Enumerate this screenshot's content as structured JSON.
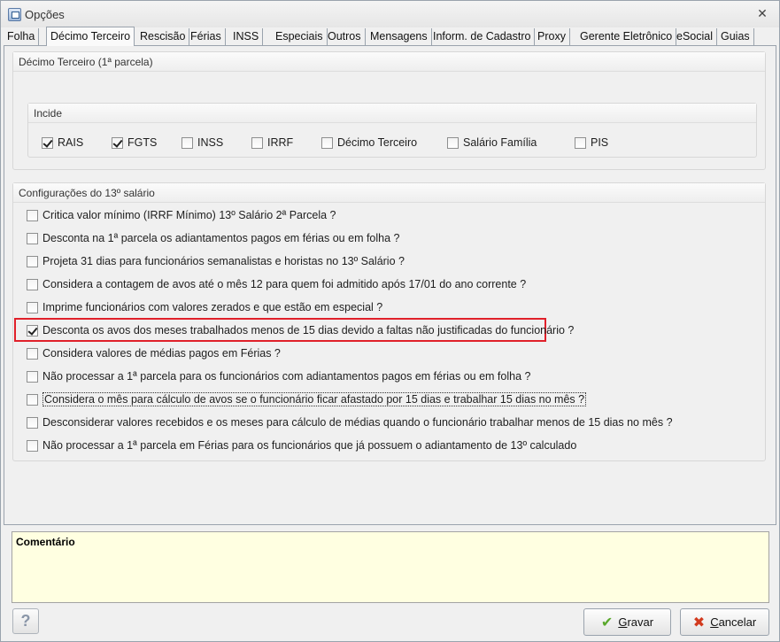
{
  "window": {
    "title": "Opções",
    "close_glyph": "✕"
  },
  "tabs": [
    {
      "label": "Folha"
    },
    {
      "label": "Décimo Terceiro",
      "active": true
    },
    {
      "label": "Rescisão"
    },
    {
      "label": "Férias"
    },
    {
      "label": "INSS"
    },
    {
      "label": "Especiais"
    },
    {
      "label": "Outros"
    },
    {
      "label": "Mensagens"
    },
    {
      "label": "Inform. de Cadastro"
    },
    {
      "label": "Proxy"
    },
    {
      "label": "Gerente Eletrônico"
    },
    {
      "label": "eSocial"
    },
    {
      "label": "Guias"
    }
  ],
  "first_parcel": {
    "title": "Décimo Terceiro (1ª parcela)",
    "incide": {
      "title": "Incide",
      "items": [
        {
          "label": "RAIS",
          "checked": true
        },
        {
          "label": "FGTS",
          "checked": true
        },
        {
          "label": "INSS",
          "checked": false
        },
        {
          "label": "IRRF",
          "checked": false
        },
        {
          "label": "Décimo Terceiro",
          "checked": false
        },
        {
          "label": "Salário Família",
          "checked": false
        },
        {
          "label": "PIS",
          "checked": false
        }
      ]
    }
  },
  "config": {
    "title": "Configurações do 13º salário",
    "items": [
      {
        "label": "Critica valor mínimo (IRRF Mínimo) 13º Salário 2ª Parcela ?",
        "checked": false
      },
      {
        "label": "Desconta na 1ª parcela os adiantamentos pagos em férias ou em folha ?",
        "checked": false
      },
      {
        "label": "Projeta 31 dias para funcionários semanalistas e horistas no 13º Salário ?",
        "checked": false
      },
      {
        "label": "Considera a contagem de avos até o mês 12 para quem foi admitido após 17/01 do ano corrente ?",
        "checked": false
      },
      {
        "label": "Imprime funcionários com valores zerados e que estão em especial ?",
        "checked": false
      },
      {
        "label": "Desconta os avos dos meses trabalhados menos de 15 dias devido a faltas não justificadas do funcionário ?",
        "checked": true,
        "highlighted": true
      },
      {
        "label": "Considera valores de médias pagos em Férias ?",
        "checked": false
      },
      {
        "label": "Não processar a 1ª parcela para os funcionários com adiantamentos pagos em férias ou em folha ?",
        "checked": false
      },
      {
        "label": "Considera o mês para cálculo de avos se o funcionário ficar afastado por 15 dias e trabalhar 15 dias no mês ?",
        "checked": false,
        "focused": true
      },
      {
        "label": "Desconsiderar valores recebidos e os meses para cálculo de médias quando o funcionário trabalhar menos de 15 dias no mês ?",
        "checked": false
      },
      {
        "label": "Não processar a 1ª parcela em Férias para os funcionários que já possuem o adiantamento de 13º calculado",
        "checked": false
      }
    ]
  },
  "comment": {
    "label": "Comentário"
  },
  "footer": {
    "help_label": "?",
    "save_label": "Gravar",
    "save_accel": "G",
    "save_rest": "ravar",
    "cancel_label": "Cancelar",
    "cancel_accel": "C",
    "cancel_rest": "ancelar",
    "save_icon": "✔",
    "cancel_icon": "✖"
  },
  "colors": {
    "highlight": "#e0202a",
    "comment_bg": "#ffffe1",
    "save_icon": "#5aa82c",
    "cancel_icon": "#d23a1e"
  }
}
